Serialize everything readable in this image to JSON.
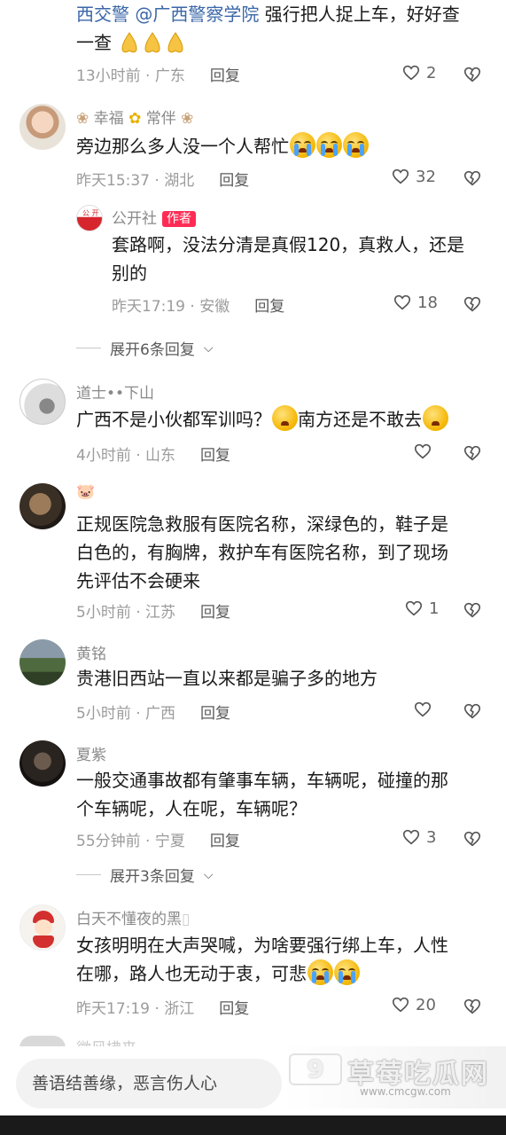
{
  "comments": [
    {
      "text_line1": "西交警 @广西警察学院 强行把人捉上车，好好查",
      "text_line1_prefix": "西交警 @广西警察学院",
      "text_line1_rest": " 强行把人捉上车，好好查",
      "text_line2": "一查",
      "time": "13小时前",
      "location": "广东",
      "reply": "回复",
      "likes": "2"
    },
    {
      "username": "幸福",
      "username_suffix": "常伴",
      "text": "旁边那么多人没一个人帮忙",
      "time": "昨天15:37",
      "location": "湖北",
      "reply": "回复",
      "likes": "32",
      "author_reply": {
        "username": "公开社",
        "badge": "作者",
        "text_line1": "套路啊，没法分清是真假120，真救人，还是",
        "text_line2": "别的",
        "time": "昨天17:19",
        "location": "安徽",
        "reply": "回复",
        "likes": "18"
      },
      "expand": "展开6条回复"
    },
    {
      "username": "道士••下山",
      "text_part1": "广西不是小伙都军训吗？",
      "text_part2": "南方还是不敢去",
      "time": "4小时前",
      "location": "山东",
      "reply": "回复"
    },
    {
      "username": "🐷",
      "text_line1": "正规医院急救服有医院名称，深绿色的，鞋子是",
      "text_line2": "白色的，有胸牌，救护车有医院名称，到了现场",
      "text_line3": "先评估不会硬来",
      "time": "5小时前",
      "location": "江苏",
      "reply": "回复",
      "likes": "1"
    },
    {
      "username": "黄铭",
      "text": "贵港旧西站一直以来都是骗子多的地方",
      "time": "5小时前",
      "location": "广西",
      "reply": "回复"
    },
    {
      "username": "夏紫",
      "text_line1": "一般交通事故都有肇事车辆，车辆呢，碰撞的那",
      "text_line2": "个车辆呢，人在呢，车辆呢？",
      "time": "55分钟前",
      "location": "宁夏",
      "reply": "回复",
      "likes": "3",
      "expand": "展开3条回复"
    },
    {
      "username": "白天不懂夜的黑",
      "text_line1": "女孩明明在大声哭喊，为啥要强行绑上车，人性",
      "text_line2": "在哪，路人也无动于衷，可悲",
      "time": "昨天17:19",
      "location": "浙江",
      "reply": "回复",
      "likes": "20"
    }
  ],
  "partial_next_username": "微风拂来",
  "input_placeholder": "善语结善缘，恶言伤人心",
  "watermark": {
    "logo": "9",
    "title": "草莓吃瓜网",
    "url": "www.cmcgw.com"
  },
  "separator": " · "
}
